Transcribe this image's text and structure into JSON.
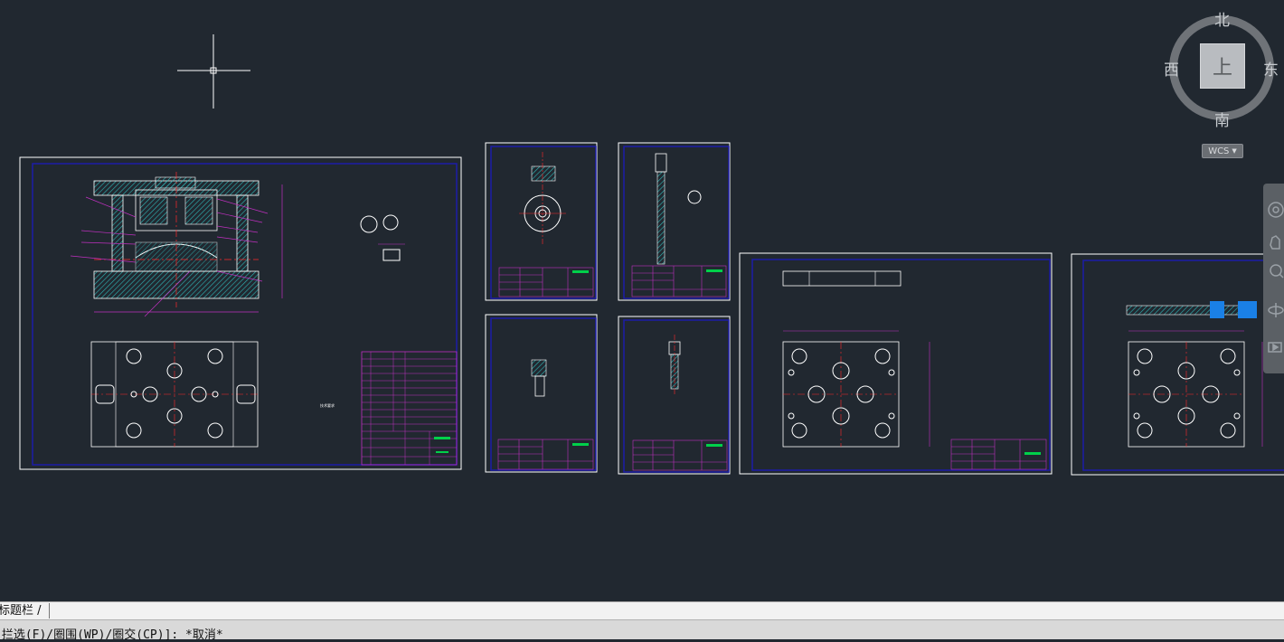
{
  "viewcube": {
    "north": "北",
    "south": "南",
    "east": "东",
    "west": "西",
    "top_face": "上",
    "wcs": "WCS"
  },
  "layout_tabs": {
    "active": "标题栏 /"
  },
  "command_line": {
    "text": "[拦选(F)/圈围(WP)/圈交(CP)]: *取消*"
  },
  "colors": {
    "background": "#212830",
    "sheet_border": "#ffffff",
    "frame": "#1c1ca8",
    "part": "#ffffff",
    "hatch": "#2fb7b7",
    "dimension": "#c030c0",
    "centerline": "#ff2a2a",
    "title_block": "#c030c0",
    "highlight": "#00d04a",
    "selection": "#1a80e6"
  },
  "icons": [
    "crosshair-cursor",
    "viewcube",
    "steering-wheel-icon",
    "pan-icon",
    "zoom-icon",
    "orbit-icon",
    "showmotion-icon"
  ]
}
